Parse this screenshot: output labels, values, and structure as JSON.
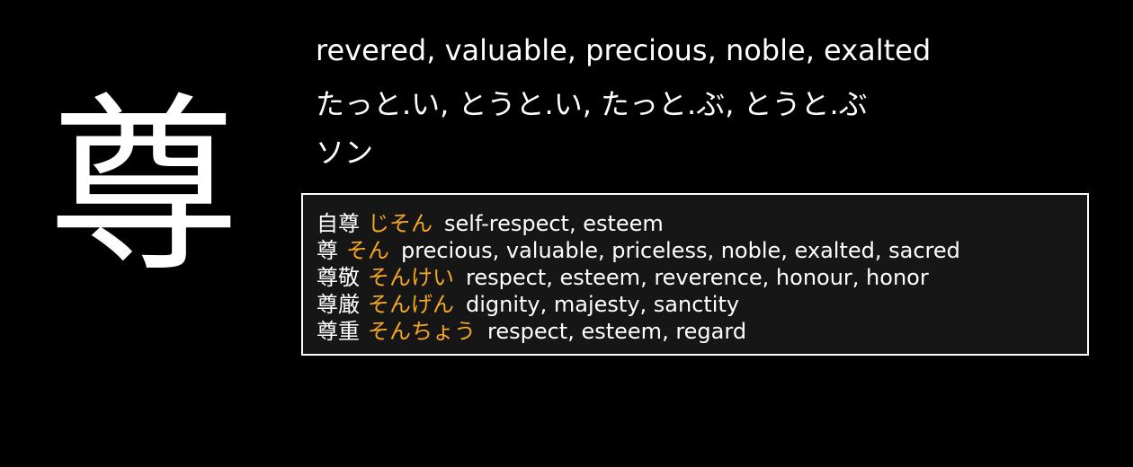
{
  "kanji": {
    "character": "尊",
    "meanings": "revered, valuable, precious, noble, exalted",
    "kun_readings": "たっと.い, とうと.い, たっと.ぶ, とうと.ぶ",
    "on_readings": "ソン"
  },
  "vocabulary": [
    {
      "word": "自尊",
      "reading": "じそん",
      "meaning": "self-respect, esteem"
    },
    {
      "word": "尊",
      "reading": "そん",
      "meaning": "precious, valuable, priceless, noble, exalted, sacred"
    },
    {
      "word": "尊敬",
      "reading": "そんけい",
      "meaning": "respect, esteem, reverence, honour, honor"
    },
    {
      "word": "尊厳",
      "reading": "そんげん",
      "meaning": "dignity, majesty, sanctity"
    },
    {
      "word": "尊重",
      "reading": "そんちょう",
      "meaning": "respect, esteem, regard"
    }
  ],
  "colors": {
    "background": "#000000",
    "text": "#ffffff",
    "reading_accent": "#f5a623",
    "box_background": "#161616",
    "box_border": "#ffffff"
  }
}
